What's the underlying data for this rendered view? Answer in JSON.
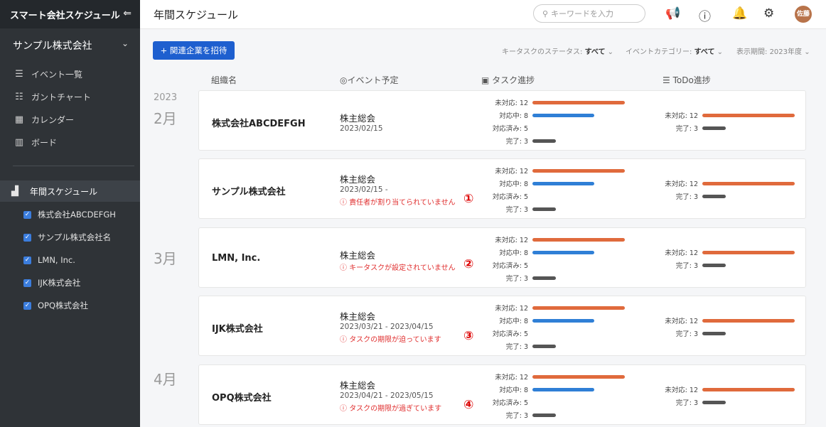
{
  "sidebar": {
    "app_title": "スマート会社スケジュール",
    "collapse_icon": "collapse-left-icon",
    "company": "サンプル株式会社",
    "nav": [
      {
        "label": "イベント一覧",
        "icon": "list-icon"
      },
      {
        "label": "ガントチャート",
        "icon": "gantt-icon"
      },
      {
        "label": "カレンダー",
        "icon": "calendar-icon"
      },
      {
        "label": "ボード",
        "icon": "board-icon"
      }
    ],
    "active": {
      "label": "年間スケジュール",
      "icon": "building-icon"
    },
    "companies": [
      "株式会社ABCDEFGH",
      "サンプル株式会社名",
      "LMN, Inc.",
      "IJK株式会社",
      "OPQ株式会社"
    ]
  },
  "header": {
    "title": "年間スケジュール",
    "search_placeholder": "キーワードを入力",
    "avatar": "佐藤"
  },
  "toolbar": {
    "invite_label": "+ 関連企業を招待",
    "filters": [
      {
        "label": "キータスクのステータス:",
        "value": "すべて"
      },
      {
        "label": "イベントカテゴリー:",
        "value": "すべて"
      },
      {
        "label": "表示期間:",
        "value": "2023年度"
      }
    ]
  },
  "columns": {
    "org": "組織名",
    "event": "イベント予定",
    "task": "タスク進捗",
    "todo": "ToDo進捗"
  },
  "timeline": {
    "year": "2023",
    "months": [
      "2月",
      "3月",
      "4月"
    ]
  },
  "labels": {
    "unhandled": "未対応: 12",
    "in_progress": "対応中: 8",
    "handled": "対応済み: 5",
    "done": "完了: 3"
  },
  "rows": [
    {
      "org": "株式会社ABCDEFGH",
      "event": "株主総会",
      "date": "2023/02/15",
      "warning": "",
      "num": ""
    },
    {
      "org": "サンプル株式会社",
      "event": "株主総会",
      "date": "2023/02/15 -",
      "warning": "責任者が割り当てられていません",
      "num": "①"
    },
    {
      "org": "LMN, Inc.",
      "event": "株主総会",
      "date": "",
      "warning": "キータスクが設定されていません",
      "num": "②"
    },
    {
      "org": "IJK株式会社",
      "event": "株主総会",
      "date": "2023/03/21 - 2023/04/15",
      "warning": "タスクの期限が迫っています",
      "num": "③"
    },
    {
      "org": "OPQ株式会社",
      "event": "株主総会",
      "date": "2023/04/21 - 2023/05/15",
      "warning": "タスクの期限が過ぎています",
      "num": "④"
    }
  ],
  "progress": {
    "unhandled": 12,
    "in_progress": 8,
    "handled": 5,
    "done": 3
  },
  "colors": {
    "orange": "#e06a3c",
    "blue": "#2f7fd6",
    "gray": "#555555",
    "accent": "#1e5fcf",
    "warning": "#e03030"
  }
}
